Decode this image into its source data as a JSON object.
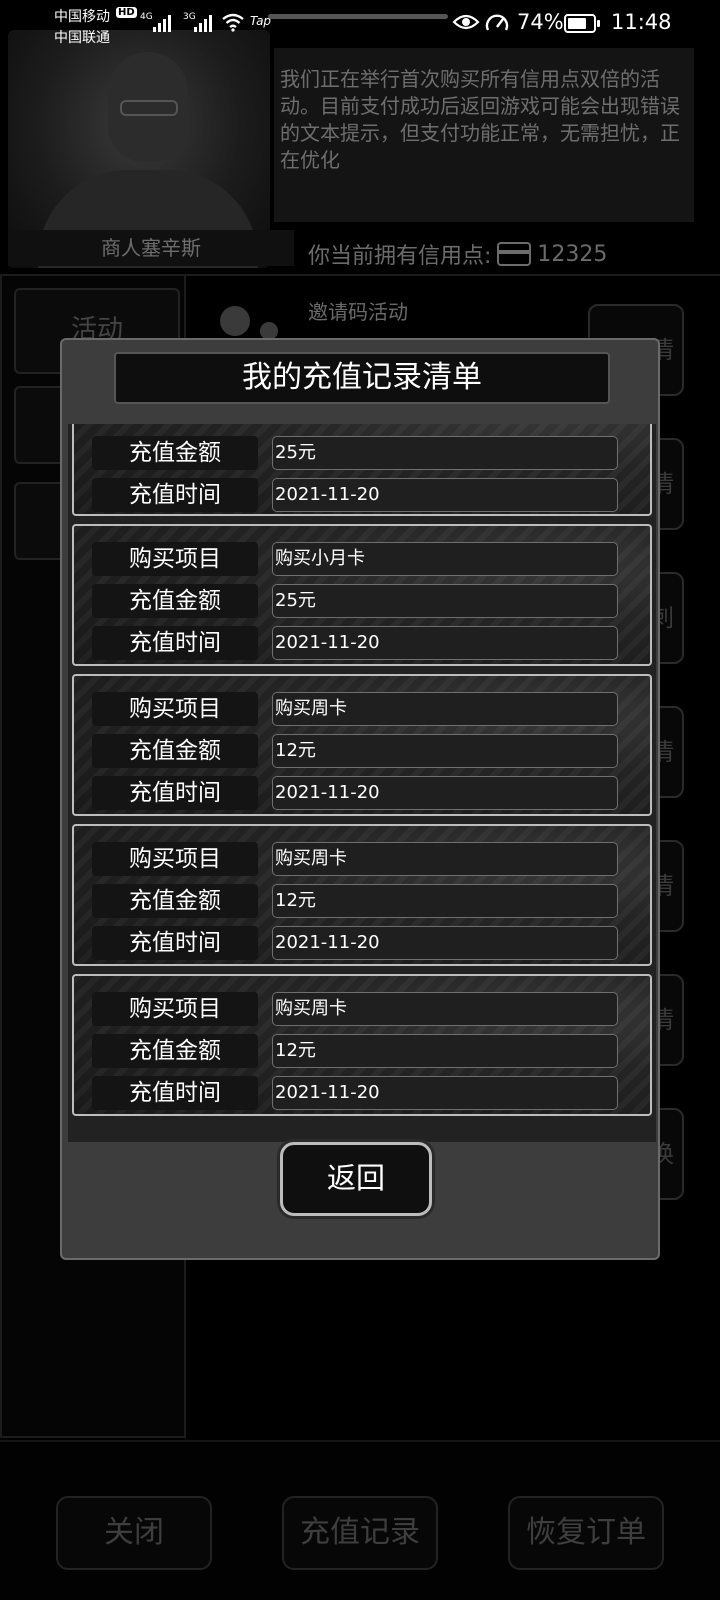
{
  "status_bar": {
    "carrier_1": "中国移动",
    "carrier_1_badge": "HD",
    "network_1": "4G",
    "carrier_2": "中国联通",
    "network_2": "3G",
    "tap_label": "Tap",
    "battery_percent": "74%",
    "battery_level": 0.74,
    "time": "11:48"
  },
  "background": {
    "merchant_name": "商人塞辛斯",
    "notice": "我们正在举行首次购买所有信用点双倍的活动。目前支付成功后返回游戏可能会出现错误的文本提示，但支付功能正常，无需担忧，正在优化",
    "credit_label": "你当前拥有信用点:",
    "credit_value": "12325",
    "left_tab_1": "活动",
    "invite_label": "邀请码活动",
    "side_buttons": [
      "情",
      "情",
      "刺",
      "情",
      "情",
      "情",
      "换"
    ],
    "bottom_buttons": {
      "close": "关闭",
      "recharge_records": "充值记录",
      "restore_orders": "恢复订单"
    }
  },
  "modal": {
    "title": "我的充值记录清单",
    "back_label": "返回",
    "records": [
      {
        "amount_label": "充值金额",
        "amount": "25元",
        "time_label": "充值时间",
        "time": "2021-11-20"
      },
      {
        "item_label": "购买项目",
        "item": "购买小月卡",
        "amount_label": "充值金额",
        "amount": "25元",
        "time_label": "充值时间",
        "time": "2021-11-20"
      },
      {
        "item_label": "购买项目",
        "item": "购买周卡",
        "amount_label": "充值金额",
        "amount": "12元",
        "time_label": "充值时间",
        "time": "2021-11-20"
      },
      {
        "item_label": "购买项目",
        "item": "购买周卡",
        "amount_label": "充值金额",
        "amount": "12元",
        "time_label": "充值时间",
        "time": "2021-11-20"
      },
      {
        "item_label": "购买项目",
        "item": "购买周卡",
        "amount_label": "充值金额",
        "amount": "12元",
        "time_label": "充值时间",
        "time": "2021-11-20"
      }
    ]
  }
}
